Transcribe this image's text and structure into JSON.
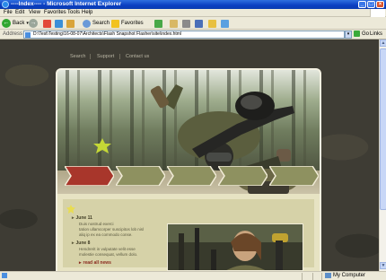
{
  "window": {
    "title": "----Index---- - Microsoft Internet Explorer",
    "buttons": {
      "minimize": "_",
      "maximize": "□",
      "close": "×"
    }
  },
  "menu": [
    "File",
    "Edit",
    "View",
    "Favorites",
    "Tools",
    "Help"
  ],
  "toolbar": {
    "back_label": "Back",
    "search_label": "Search",
    "favorites_label": "Favorites"
  },
  "address": {
    "label": "Address",
    "url": "D:\\Test\\Testing\\16-08-07\\Architects\\Flash Snapshot Flasher\\site\\index.html",
    "go_label": "Go",
    "links_label": "Links"
  },
  "status": {
    "zone": "My Computer"
  },
  "site": {
    "nav": [
      "Search",
      "Support",
      "Contact us"
    ],
    "news": [
      {
        "date": "June 11",
        "lines": [
          "Duis nostrud exerci",
          "tation ullamcorper suscipitos lob nisl",
          "aliq ip ex ea commodo conse."
        ]
      },
      {
        "date": "June 8",
        "lines": [
          "Hendrerit in vulputate velit esse",
          "molestie consequat, vellum dolo."
        ]
      }
    ],
    "read_all": "read all news"
  },
  "colors": {
    "active_tab": "#a8362b",
    "tab": "#8e9160",
    "panel": "#e7e3c3",
    "background": "#3e3c34"
  }
}
